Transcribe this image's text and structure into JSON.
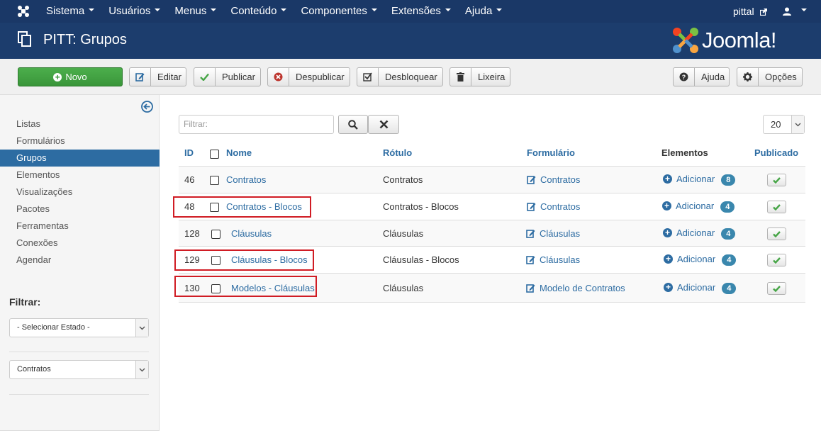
{
  "navbar": {
    "menu": [
      "Sistema",
      "Usuários",
      "Menus",
      "Conteúdo",
      "Componentes",
      "Extensões",
      "Ajuda"
    ],
    "user": "pittal"
  },
  "header": {
    "title": "PITT: Grupos",
    "brand": "Joomla!"
  },
  "toolbar": {
    "new": "Novo",
    "edit": "Editar",
    "publish": "Publicar",
    "unpublish": "Despublicar",
    "unlock": "Desbloquear",
    "trash": "Lixeira",
    "help": "Ajuda",
    "options": "Opções"
  },
  "sidebar": {
    "items": [
      "Listas",
      "Formulários",
      "Grupos",
      "Elementos",
      "Visualizações",
      "Pacotes",
      "Ferramentas",
      "Conexões",
      "Agendar"
    ],
    "active_index": 2,
    "filter_title": "Filtrar:",
    "state_select": "- Selecionar Estado -",
    "form_select": "Contratos"
  },
  "search": {
    "placeholder": "Filtrar:"
  },
  "list_limit": "20",
  "table": {
    "headers": {
      "id": "ID",
      "name": "Nome",
      "label": "Rótulo",
      "form": "Formulário",
      "elements": "Elementos",
      "published": "Publicado"
    },
    "add_label": "Adicionar",
    "rows": [
      {
        "id": "46",
        "name": "Contratos",
        "label": "Contratos",
        "form": "Contratos",
        "count": "8",
        "published": true,
        "highlighted": false
      },
      {
        "id": "48",
        "name": "Contratos - Blocos",
        "label": "Contratos - Blocos",
        "form": "Contratos",
        "count": "4",
        "published": true,
        "highlighted": true
      },
      {
        "id": "128",
        "name": "Cláusulas",
        "label": "Cláusulas",
        "form": "Cláusulas",
        "count": "4",
        "published": true,
        "highlighted": false
      },
      {
        "id": "129",
        "name": "Cláusulas - Blocos",
        "label": "Cláusulas - Blocos",
        "form": "Cláusulas",
        "count": "4",
        "published": true,
        "highlighted": true
      },
      {
        "id": "130",
        "name": "Modelos - Cláusulas",
        "label": "Cláusulas",
        "form": "Modelo de Contratos",
        "count": "4",
        "published": true,
        "highlighted": true
      }
    ]
  },
  "colors": {
    "navbar": "#1a3867",
    "header": "#1c3d6d",
    "link": "#2d6ca2",
    "success": "#46a546",
    "highlight": "#d01c24"
  }
}
